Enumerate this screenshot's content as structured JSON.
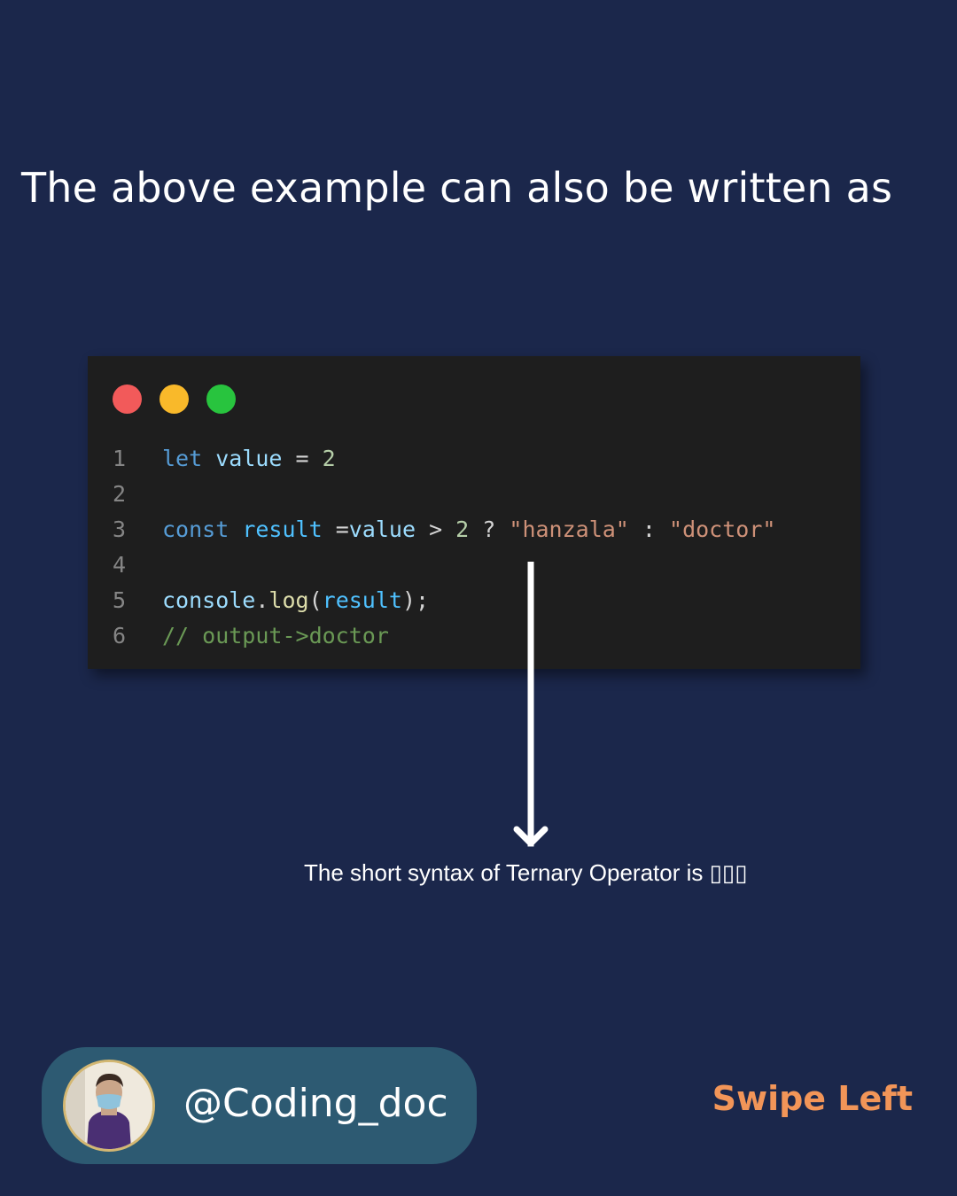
{
  "heading": "The above example can also be written as",
  "code_window": {
    "buttons": {
      "close_color": "#f25a5a",
      "minimize_color": "#f9b92a",
      "maximize_color": "#28c43e"
    },
    "lines": [
      {
        "number": "1",
        "tokens": [
          {
            "text": "let",
            "color": "#569cd6"
          },
          {
            "text": " ",
            "color": "#d4d4d4"
          },
          {
            "text": "value",
            "color": "#9cdcfe"
          },
          {
            "text": " = ",
            "color": "#d4d4d4"
          },
          {
            "text": "2",
            "color": "#b5cea8"
          }
        ]
      },
      {
        "number": "2",
        "tokens": []
      },
      {
        "number": "3",
        "tokens": [
          {
            "text": "const",
            "color": "#569cd6"
          },
          {
            "text": " ",
            "color": "#d4d4d4"
          },
          {
            "text": "result",
            "color": "#4fc1ff"
          },
          {
            "text": " =",
            "color": "#d4d4d4"
          },
          {
            "text": "value",
            "color": "#9cdcfe"
          },
          {
            "text": " > ",
            "color": "#d4d4d4"
          },
          {
            "text": "2",
            "color": "#b5cea8"
          },
          {
            "text": " ? ",
            "color": "#d4d4d4"
          },
          {
            "text": "\"hanzala\"",
            "color": "#ce9178"
          },
          {
            "text": " : ",
            "color": "#d4d4d4"
          },
          {
            "text": "\"doctor\"",
            "color": "#ce9178"
          }
        ]
      },
      {
        "number": "4",
        "tokens": []
      },
      {
        "number": "5",
        "tokens": [
          {
            "text": "console",
            "color": "#9cdcfe"
          },
          {
            "text": ".",
            "color": "#d4d4d4"
          },
          {
            "text": "log",
            "color": "#dcdcaa"
          },
          {
            "text": "(",
            "color": "#d4d4d4"
          },
          {
            "text": "result",
            "color": "#4fc1ff"
          },
          {
            "text": ");",
            "color": "#d4d4d4"
          }
        ]
      },
      {
        "number": "6",
        "tokens": [
          {
            "text": "// output->doctor",
            "color": "#6a9955"
          }
        ]
      }
    ]
  },
  "caption": "The short syntax of Ternary Operator is ▯▯▯",
  "profile": {
    "handle": "@Coding_doc",
    "avatar_icon": "person-avatar"
  },
  "swipe_label": "Swipe Left",
  "colors": {
    "background": "#1b274b",
    "swipe": "#f29558",
    "profile_pill": "#2d5a72"
  }
}
